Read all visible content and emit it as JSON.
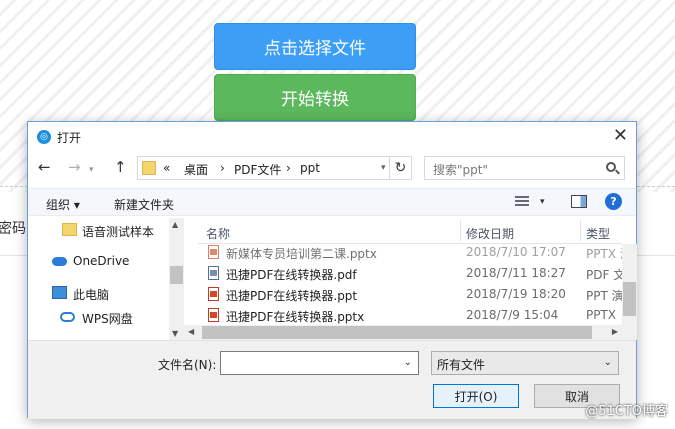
{
  "background": {
    "select_file_button": "点击选择文件",
    "start_convert_button": "开始转换",
    "side_text": "密码",
    "watermark": "@51CTO博客"
  },
  "dialog": {
    "title": "打开",
    "close": "✕",
    "nav": {
      "back": "←",
      "forward": "→",
      "up": "↑",
      "history_dd": "▾",
      "refresh": "↻"
    },
    "address": {
      "prefix": "«",
      "crumbs": [
        "桌面",
        "PDF文件",
        "ppt"
      ],
      "separator": "›"
    },
    "search": {
      "placeholder": "搜索\"ppt\""
    },
    "toolbar": {
      "organize": "组织 ▾",
      "new_folder": "新建文件夹",
      "help": "?"
    },
    "nav_pane": [
      {
        "label": "语音测试样本",
        "icon": "folder-icon"
      },
      {
        "label": "OneDrive",
        "icon": "cloud-icon"
      },
      {
        "label": "此电脑",
        "icon": "computer-icon"
      },
      {
        "label": "WPS网盘",
        "icon": "wps-cloud-icon"
      }
    ],
    "columns": {
      "name": "名称",
      "date": "修改日期",
      "type": "类型"
    },
    "files": [
      {
        "name": "新媒体专员培训第二课.pptx",
        "date": "2018/7/10 17:07",
        "type": "PPTX 演",
        "kind": "ppt"
      },
      {
        "name": "迅捷PDF在线转换器.pdf",
        "date": "2018/7/11 18:27",
        "type": "PDF 文",
        "kind": "pdf"
      },
      {
        "name": "迅捷PDF在线转换器.ppt",
        "date": "2018/7/19 18:20",
        "type": "PPT 演",
        "kind": "ppt"
      },
      {
        "name": "迅捷PDF在线转换器.pptx",
        "date": "2018/7/9 15:04",
        "type": "PPTX",
        "kind": "ppt"
      }
    ],
    "filename": {
      "label": "文件名(N):",
      "value": ""
    },
    "filetype": {
      "selected": "所有文件"
    },
    "buttons": {
      "open": "打开(O)",
      "cancel": "取消"
    }
  },
  "colors": {
    "blue_button": "#3c9ff5",
    "green_button": "#5cb85c",
    "open_button_border": "#0078d7"
  }
}
